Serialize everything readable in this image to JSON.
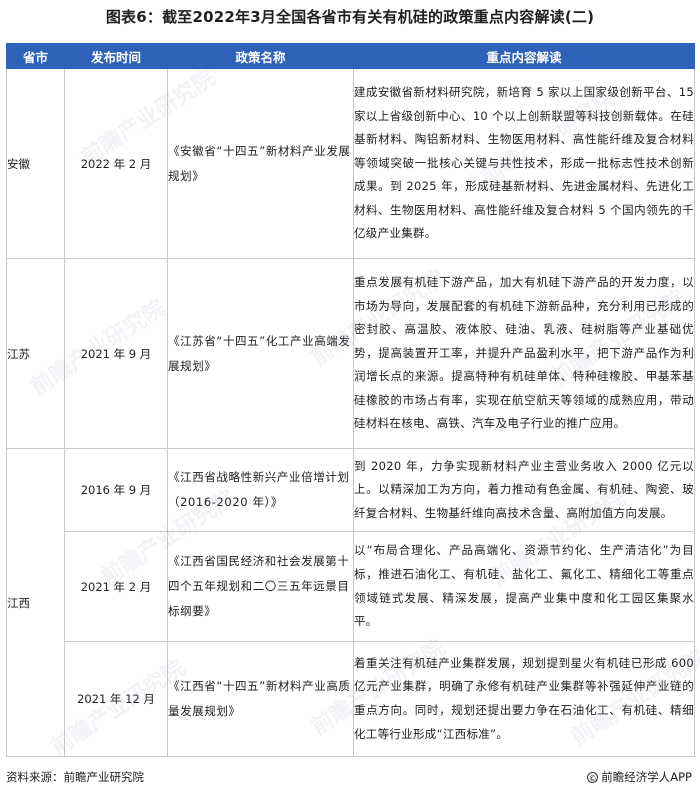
{
  "title": "图表6：截至2022年3月全国各省市有关有机硅的政策重点内容解读(二)",
  "headers": [
    "省市",
    "发布时间",
    "政策名称",
    "重点内容解读"
  ],
  "watermark": "前瞻产业研究院",
  "rows": [
    {
      "province": "安徽",
      "date": "2022 年 2 月",
      "policy": "《安徽省“十四五”新材料产业发展规划》",
      "content": "建成安徽省新材料研究院，新培育 5 家以上国家级创新平台、15 家以上省级创新中心、10 个以上创新联盟等科技创新载体。在硅基新材料、陶铝新材料、生物医用材料、高性能纤维及复合材料等领域突破一批核心关键与共性技术，形成一批标志性技术创新成果。到 2025 年，形成硅基新材料、先进金属材料、先进化工材料、生物医用材料、高性能纤维及复合材料 5 个国内领先的千亿级产业集群。"
    },
    {
      "province": "江苏",
      "date": "2021 年 9 月",
      "policy": "《江苏省“十四五”化工产业高端发展规划》",
      "content": "重点发展有机硅下游产品，加大有机硅下游产品的开发力度，以市场为导向，发展配套的有机硅下游新品种，充分利用已形成的密封胶、高温胶、液体胶、硅油、乳液、硅树脂等产业基础优势，提高装置开工率，并提升产品盈利水平，把下游产品作为利润增长点的来源。提高特种有机硅单体、特种硅橡胶、甲基苯基硅橡胶的市场占有率，实现在航空航天等领域的成熟应用，带动硅材料在核电、高铁、汽车及电子行业的推广应用。"
    },
    {
      "province": "江西",
      "date": "2016 年 9 月",
      "policy": "《江西省战略性新兴产业倍增计划（2016-2020 年）》",
      "content": "到 2020 年，力争实现新材料产业主营业务收入 2000 亿元以上。以精深加工为方向，着力推动有色金属、有机硅、陶瓷、玻纤复合材料、生物基纤维向高技术含量、高附加值方向发展。"
    },
    {
      "date": "2021 年 2 月",
      "policy": "《江西省国民经济和社会发展第十四个五年规划和二〇三五年远景目标纲要》",
      "content": "以“布局合理化、产品高端化、资源节约化、生产清洁化”为目标，推进石油化工、有机硅、盐化工、氟化工、精细化工等重点领域链式发展、精深发展，提高产业集中度和化工园区集聚水平。"
    },
    {
      "date": "2021 年 12 月",
      "policy": "《江西省“十四五”新材料产业高质量发展规划》",
      "content": "着重关注有机硅产业集群发展，规划提到星火有机硅已形成 600 亿元产业集群，明确了永修有机硅产业集群等补强延伸产业链的重点方向。同时，规划还提出要力争在石油化工、有机硅、精细化工等行业形成“江西标准”。"
    }
  ],
  "footer": {
    "source": "资料来源：前瞻产业研究院",
    "brand": "前瞻经济学人APP",
    "copyright_symbol": "©"
  }
}
